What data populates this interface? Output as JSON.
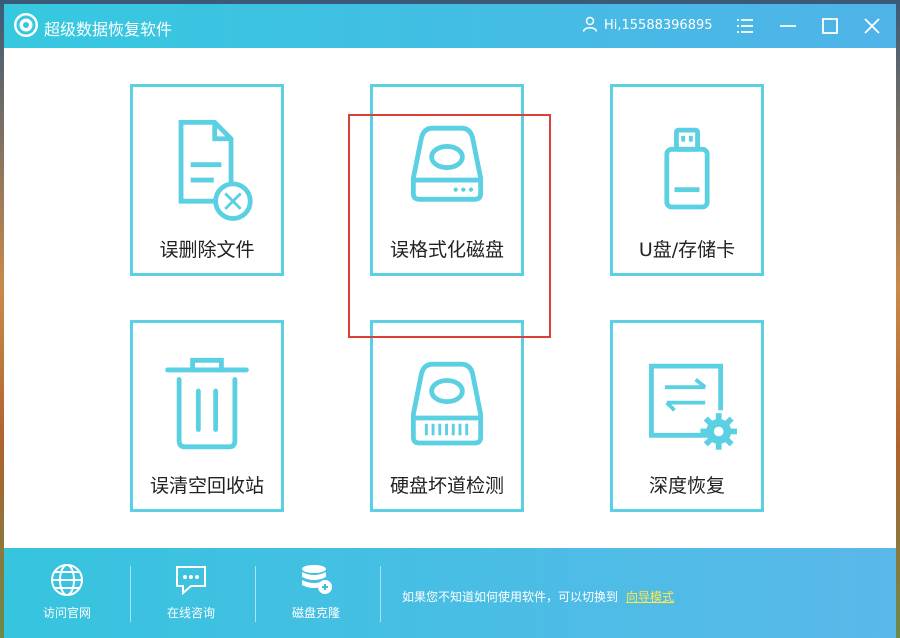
{
  "app": {
    "title": "超级数据恢复软件",
    "user": "Hi,15588396895"
  },
  "tiles": [
    {
      "label": "误删除文件",
      "icon": "deleted-file-icon"
    },
    {
      "label": "误格式化磁盘",
      "icon": "format-disk-icon"
    },
    {
      "label": "U盘/存储卡",
      "icon": "usb-drive-icon"
    },
    {
      "label": "误清空回收站",
      "icon": "recycle-bin-icon"
    },
    {
      "label": "硬盘坏道检测",
      "icon": "hard-disk-check-icon"
    },
    {
      "label": "深度恢复",
      "icon": "deep-recovery-icon"
    }
  ],
  "footer": {
    "items": [
      {
        "label": "访问官网",
        "icon": "globe-icon"
      },
      {
        "label": "在线咨询",
        "icon": "chat-icon"
      },
      {
        "label": "磁盘克隆",
        "icon": "disk-clone-icon"
      }
    ],
    "hint_text": "如果您不知道如何使用软件，可以切换到",
    "hint_link": "向导模式"
  },
  "colors": {
    "accent": "#5bd0e2",
    "titlebar": "#35c9df",
    "highlight": "#d9403a",
    "link": "#ffe94a"
  }
}
